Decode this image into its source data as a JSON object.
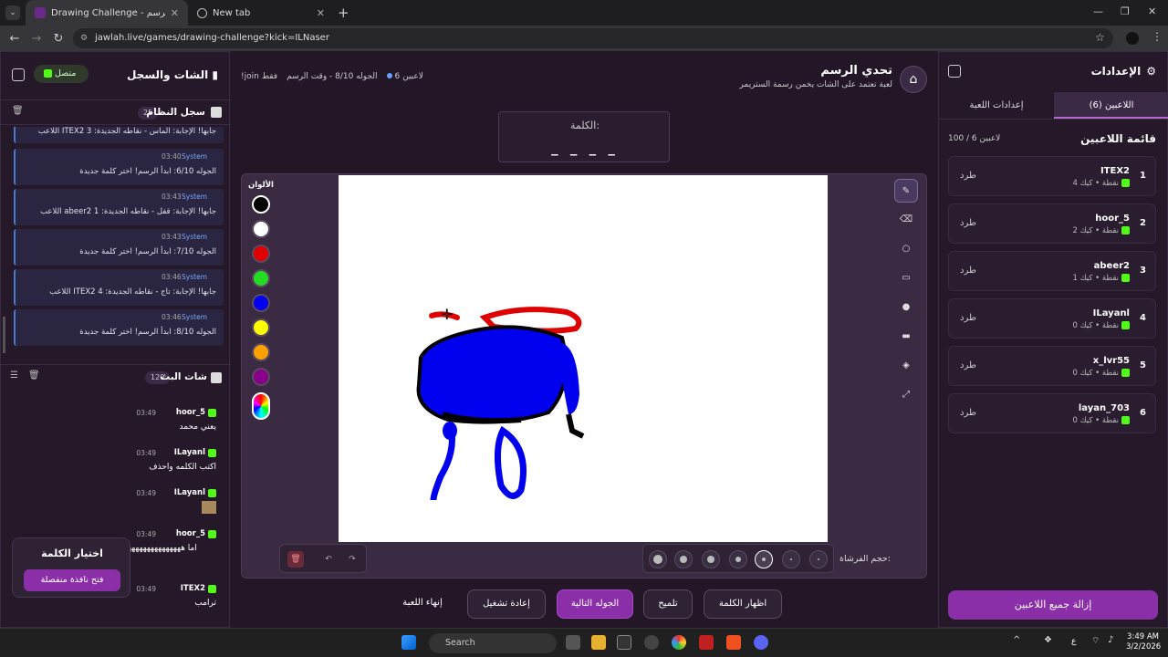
{
  "browser": {
    "tabs": [
      {
        "title": "Drawing Challenge - تحدي الرسم",
        "active": true
      },
      {
        "title": "New tab",
        "active": false
      }
    ],
    "url": "jawlah.live/games/drawing-challenge?kick=ILNaser"
  },
  "settings": {
    "title": "الإعدادات",
    "tabs": [
      "اللاعبين (6)",
      "إعدادات اللعبة"
    ],
    "players_title": "قائمة اللاعبين",
    "players_count": "100 / 6 لاعبين",
    "kick_label": "طرد",
    "platform": "كيك",
    "players": [
      {
        "idx": "1",
        "name": "ITEX2",
        "points": "4 نقطة"
      },
      {
        "idx": "2",
        "name": "hoor_5",
        "points": "2 نقطة"
      },
      {
        "idx": "3",
        "name": "abeer2",
        "points": "1 نقطة"
      },
      {
        "idx": "4",
        "name": "ILayanl",
        "points": "0 نقطة"
      },
      {
        "idx": "5",
        "name": "x_lvr55",
        "points": "0 نقطة"
      },
      {
        "idx": "6",
        "name": "layan_703",
        "points": "0 نقطة"
      }
    ],
    "kick_all": "إزالة جميع اللاعبين"
  },
  "chat": {
    "title": "الشات والسجل",
    "status": "متصل",
    "syslog_title": "سجل النظام",
    "syslog_count": "25",
    "syslog": [
      {
        "time": "",
        "who": "",
        "text": "اللاعب ITEX2 جابها! الإجابة: الماس - نقاطه الجديدة: 3"
      },
      {
        "time": "03:40",
        "who": "System",
        "text": "الجوله 6/10: ابدأ الرسم! اختر كلمة جديدة"
      },
      {
        "time": "03:43",
        "who": "System",
        "text": "اللاعب abeer2 جابها! الإجابة: قفل - نقاطه الجديدة: 1"
      },
      {
        "time": "03:43",
        "who": "System",
        "text": "الجوله 7/10: ابدأ الرسم! اختر كلمة جديدة"
      },
      {
        "time": "03:46",
        "who": "System",
        "text": "اللاعب ITEX2 جابها! الإجابة: تاج - نقاطه الجديدة: 4"
      },
      {
        "time": "03:46",
        "who": "System",
        "text": "الجوله 8/10: ابدأ الرسم! اختر كلمة جديدة"
      }
    ],
    "stream_title": "شات البث",
    "stream_count": "120",
    "messages": [
      {
        "user": "hoor_5",
        "time": "03:49",
        "text": "يعني محمد"
      },
      {
        "user": "ILayanl",
        "time": "03:49",
        "text": "اكتب الكلمه واحذف"
      },
      {
        "user": "ILayanl",
        "time": "03:49",
        "text": ""
      },
      {
        "user": "hoor_5",
        "time": "03:49",
        "text": "اما هههههههههههههههههه"
      },
      {
        "user": "ITEX2",
        "time": "03:49",
        "text": "ترامب"
      }
    ],
    "pick_title": "اختيار الكلمة",
    "pick_button": "فتح نافذة منفصلة"
  },
  "game": {
    "title": "تحدي الرسم",
    "subtitle": "لعبة تعتمد على الشات يخمن رسمة الستريمر",
    "players_info": "6 لاعبين",
    "round_info": "الجوله 8/10 - وقت الرسم",
    "join_info": "!join فقط",
    "word_label": "الكلمة:",
    "word_mask": "_ _ _ _",
    "colors_label": "الألوان",
    "colors": [
      "#000000",
      "#ffffff",
      "#e00000",
      "#22dd22",
      "#0000ee",
      "#ffff00",
      "#ffa000",
      "#880088"
    ],
    "brush_label": "حجم الفرشاة:",
    "buttons": {
      "show_word": "اظهار الكلمة",
      "hint": "تلميح",
      "next_round": "الجوله التالية",
      "restart": "إعادة تشغيل",
      "end_game": "إنهاء اللعبة"
    }
  },
  "taskbar": {
    "search": "Search",
    "lang": "ع",
    "time": "3:49 AM",
    "date": "3/2/2026"
  }
}
